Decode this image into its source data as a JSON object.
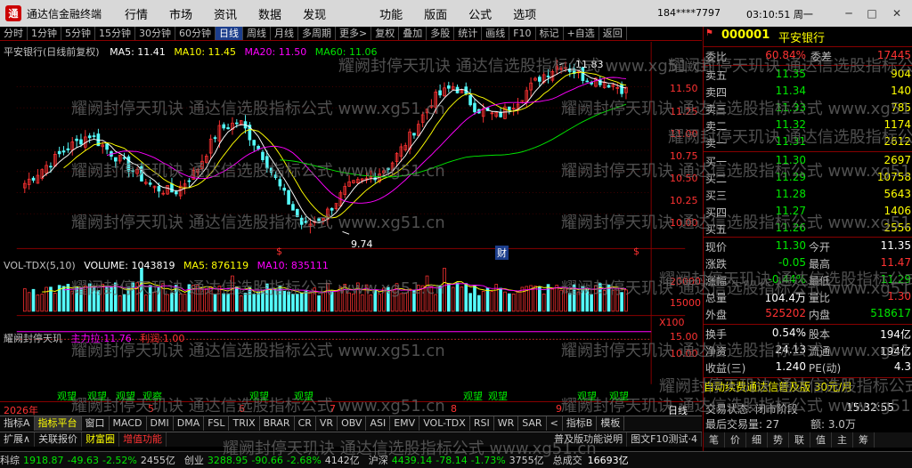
{
  "title_bar": {
    "app_title": "通达信金融终端",
    "menus": [
      "行情",
      "市场",
      "资讯",
      "数据",
      "发现",
      "功能",
      "版面",
      "公式",
      "选项"
    ],
    "account": "184****7797",
    "clock": "03:10:51 周一"
  },
  "toolbar": {
    "items": [
      "分时",
      "1分钟",
      "5分钟",
      "15分钟",
      "30分钟",
      "60分钟",
      "日线",
      "周线",
      "月线",
      "多周期",
      "更多>",
      "复权",
      "叠加",
      "多股",
      "统计",
      "画线",
      "F10",
      "标记",
      "+自选",
      "返回"
    ],
    "active": "日线"
  },
  "main_legend": {
    "title": "平安银行(日线前复权)",
    "ma5": "MA5: 11.41",
    "ma10": "MA10: 11.45",
    "ma20": "MA20: 11.50",
    "ma60": "MA60: 11.06",
    "high_label": "11.83",
    "low_label": "9.74",
    "marker_s1": "$",
    "marker_s2": "$",
    "marker_cai": "财"
  },
  "price_axis": [
    "11.50",
    "11.25",
    "11.00",
    "10.75",
    "10.50",
    "10.25",
    "10.00"
  ],
  "vol_legend": {
    "title": "VOL-TDX(5,10)",
    "volume": "VOLUME: 1043819",
    "ma5": "MA5: 876119",
    "ma10": "MA10: 835111"
  },
  "vol_axis": [
    "20000",
    "15000",
    "X100"
  ],
  "ind_legend": {
    "title": "耀阙封停天玑",
    "a": "主力拉:11.76",
    "b": "利润:1.00"
  },
  "ind_axis": [
    "15.00",
    "10.00"
  ],
  "signals": [
    "观望",
    "观望",
    "观望",
    "观察",
    "观望",
    "观望",
    "观望",
    "观望",
    "观望",
    "观望",
    "观望"
  ],
  "dates": {
    "year": "2026年",
    "m5": "5",
    "m6": "6",
    "m7": "7",
    "m8": "8",
    "m9": "9"
  },
  "period_label": "日线",
  "quote": {
    "code": "000001",
    "name": "平安银行",
    "weibi_label": "委比",
    "weibi": "60.84%",
    "weicha_label": "委差",
    "weicha": "17445",
    "sell": [
      {
        "label": "卖五",
        "price": "11.35",
        "vol": "904"
      },
      {
        "label": "卖四",
        "price": "11.34",
        "vol": "140"
      },
      {
        "label": "卖三",
        "price": "11.33",
        "vol": "785"
      },
      {
        "label": "卖二",
        "price": "11.32",
        "vol": "1174"
      },
      {
        "label": "卖一",
        "price": "11.31",
        "vol": "2612"
      }
    ],
    "buy": [
      {
        "label": "买一",
        "price": "11.30",
        "vol": "2697"
      },
      {
        "label": "买二",
        "price": "11.29",
        "vol": "10758"
      },
      {
        "label": "买三",
        "price": "11.28",
        "vol": "5643"
      },
      {
        "label": "买四",
        "price": "11.27",
        "vol": "1406"
      },
      {
        "label": "买五",
        "price": "11.26",
        "vol": "2556"
      }
    ],
    "stats": [
      {
        "k": "现价",
        "v": "11.30",
        "k2": "今开",
        "v2": "11.35"
      },
      {
        "k": "涨跌",
        "v": "-0.05",
        "k2": "最高",
        "v2": "11.47"
      },
      {
        "k": "涨幅",
        "v": "-0.44%",
        "k2": "最低",
        "v2": "11.29"
      },
      {
        "k": "总量",
        "v": "104.4万",
        "k2": "量比",
        "v2": "1.30"
      },
      {
        "k": "外盘",
        "v": "525202",
        "k2": "内盘",
        "v2": "518617"
      }
    ],
    "stats2": [
      {
        "k": "换手",
        "v": "0.54%",
        "k2": "股本",
        "v2": "194亿"
      },
      {
        "k": "净资",
        "v": "24.13",
        "k2": "流通",
        "v2": "194亿"
      },
      {
        "k": "收益(三)",
        "v": "1.240",
        "k2": "PE(动)",
        "v2": "4.3"
      }
    ],
    "promo": "自动续费通达信普及版 30元/月",
    "trade_state": "交易状态: 闭市阶段",
    "trade_time": "15:32:55",
    "last_vol": "最后交易量: 27",
    "last_amt": "额: 3.0万",
    "mini_tabs": [
      "笔",
      "价",
      "细",
      "势",
      "联",
      "值",
      "主",
      "筹"
    ]
  },
  "tabs1": [
    "指标A",
    "指标平台",
    "窗口",
    "MACD",
    "DMI",
    "DMA",
    "FSL",
    "TRIX",
    "BRAR",
    "CR",
    "VR",
    "OBV",
    "ASI",
    "EMV",
    "VOL-TDX",
    "RSI",
    "WR",
    "SAR",
    "<",
    "指标B",
    "模板"
  ],
  "tabs1_sel": "指标平台",
  "tabs2": [
    "扩展∧",
    "关联报价",
    "财富圈",
    "增值功能"
  ],
  "tabs2_right": [
    "普及版功能说明",
    "图文F10测试·4"
  ],
  "status": [
    {
      "label": "科综",
      "val": "1918.87",
      "chg": "-49.63",
      "pct": "-2.52%",
      "amt": "2455亿"
    },
    {
      "label": "创业",
      "val": "3288.95",
      "chg": "-90.66",
      "pct": "-2.68%",
      "amt": "4142亿"
    },
    {
      "label": "沪深",
      "val": "4439.14",
      "chg": "-78.14",
      "pct": "-1.73%",
      "amt": "3755亿"
    }
  ],
  "status_total_label": "总成交",
  "status_total": "16693亿",
  "watermark": "耀阙封停天玑诀 通达信选股指标公式 www.xg51.cn",
  "chart_data": {
    "type": "candlestick",
    "price_ylim": [
      9.7,
      11.85
    ],
    "vol_ylim": [
      0,
      23000
    ],
    "high": 11.83,
    "low": 9.74
  }
}
